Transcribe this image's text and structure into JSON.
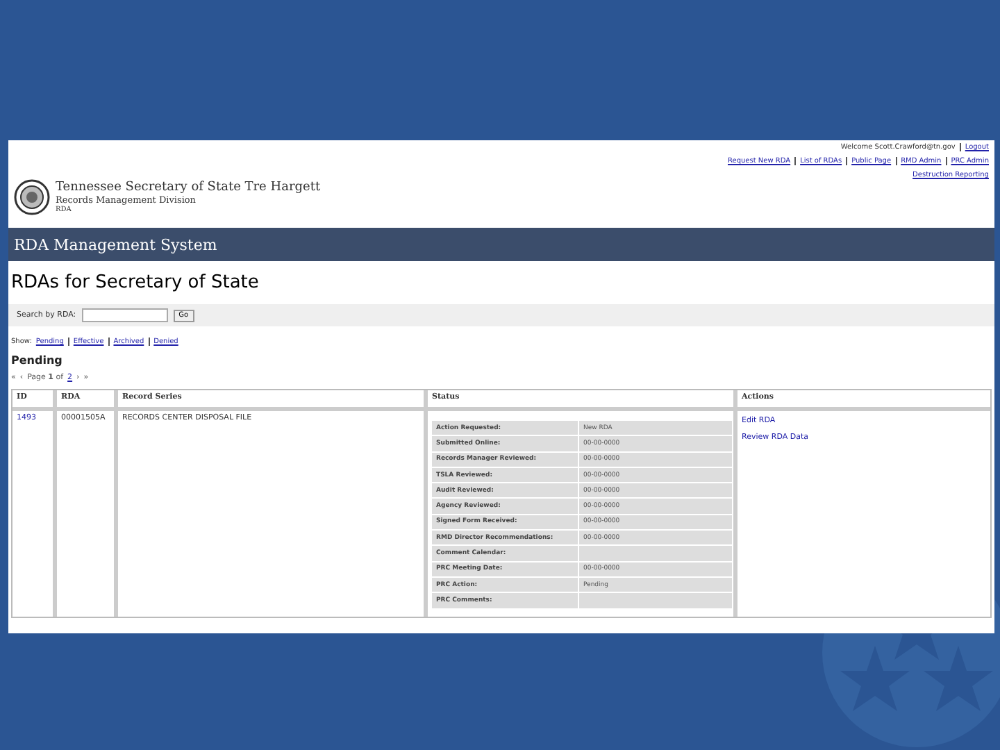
{
  "user_bar": {
    "welcome": "Welcome Scott.Crawford@tn.gov",
    "logout": "Logout"
  },
  "top_links": [
    "Request New RDA",
    "List of RDAs",
    "Public Page",
    "RMD Admin",
    "PRC Admin"
  ],
  "extra_link": "Destruction Reporting",
  "org": {
    "title": "Tennessee Secretary of State Tre Hargett",
    "division": "Records Management Division",
    "app": "RDA"
  },
  "banner": "RDA Management System",
  "heading": "RDAs for Secretary of State",
  "search": {
    "label": "Search by RDA:",
    "button": "Go"
  },
  "show": {
    "label": "Show:",
    "filters": [
      "Pending",
      "Effective",
      "Archived",
      "Denied"
    ]
  },
  "section": "Pending",
  "pager": {
    "first": "«",
    "prev": "‹",
    "text": "Page **1** of",
    "total": "2",
    "next": "›",
    "last": "»"
  },
  "table": {
    "columns": [
      "ID",
      "RDA",
      "Record Series",
      "Status",
      "Actions"
    ],
    "rows": [
      {
        "id": "1493",
        "rda": "00001505A",
        "record_series": "RECORDS CENTER DISPOSAL FILE",
        "status": [
          {
            "label": "Action Requested:",
            "value": "New RDA"
          },
          {
            "label": "Submitted Online:",
            "value": "00-00-0000"
          },
          {
            "label": "Records Manager Reviewed:",
            "value": "00-00-0000"
          },
          {
            "label": "TSLA Reviewed:",
            "value": "00-00-0000"
          },
          {
            "label": "Audit Reviewed:",
            "value": "00-00-0000"
          },
          {
            "label": "Agency Reviewed:",
            "value": "00-00-0000"
          },
          {
            "label": "Signed Form Received:",
            "value": "00-00-0000"
          },
          {
            "label": "RMD Director Recommendations:",
            "value": "00-00-0000"
          },
          {
            "label": "Comment Calendar:"
          },
          {
            "label": "PRC Meeting Date:",
            "value": "00-00-0000"
          },
          {
            "label": "PRC Action:",
            "value": "Pending"
          },
          {
            "label": "PRC Comments:"
          }
        ],
        "actions": [
          "Edit RDA",
          "Review RDA Data"
        ]
      }
    ]
  }
}
